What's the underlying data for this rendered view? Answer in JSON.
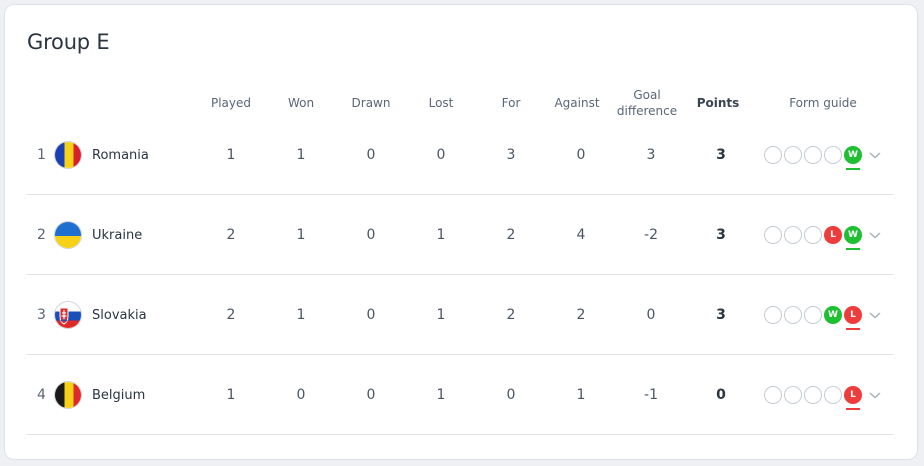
{
  "group_title": "Group E",
  "headers": {
    "played": "Played",
    "won": "Won",
    "drawn": "Drawn",
    "lost": "Lost",
    "for": "For",
    "against": "Against",
    "goal_difference_line1": "Goal",
    "goal_difference_line2": "difference",
    "points": "Points",
    "form_guide": "Form guide"
  },
  "rows": [
    {
      "pos": "1",
      "team": "Romania",
      "played": "1",
      "won": "1",
      "drawn": "0",
      "lost": "0",
      "for": "3",
      "against": "0",
      "gd": "3",
      "points": "3",
      "form": [
        "",
        "",
        "",
        "",
        "W"
      ]
    },
    {
      "pos": "2",
      "team": "Ukraine",
      "played": "2",
      "won": "1",
      "drawn": "0",
      "lost": "1",
      "for": "2",
      "against": "4",
      "gd": "-2",
      "points": "3",
      "form": [
        "",
        "",
        "",
        "L",
        "W"
      ]
    },
    {
      "pos": "3",
      "team": "Slovakia",
      "played": "2",
      "won": "1",
      "drawn": "0",
      "lost": "1",
      "for": "2",
      "against": "2",
      "gd": "0",
      "points": "3",
      "form": [
        "",
        "",
        "",
        "W",
        "L"
      ]
    },
    {
      "pos": "4",
      "team": "Belgium",
      "played": "1",
      "won": "0",
      "drawn": "0",
      "lost": "1",
      "for": "0",
      "against": "1",
      "gd": "-1",
      "points": "0",
      "form": [
        "",
        "",
        "",
        "",
        "L"
      ]
    }
  ],
  "colors": {
    "win": "#1fbf32",
    "loss": "#ee3b3b"
  }
}
